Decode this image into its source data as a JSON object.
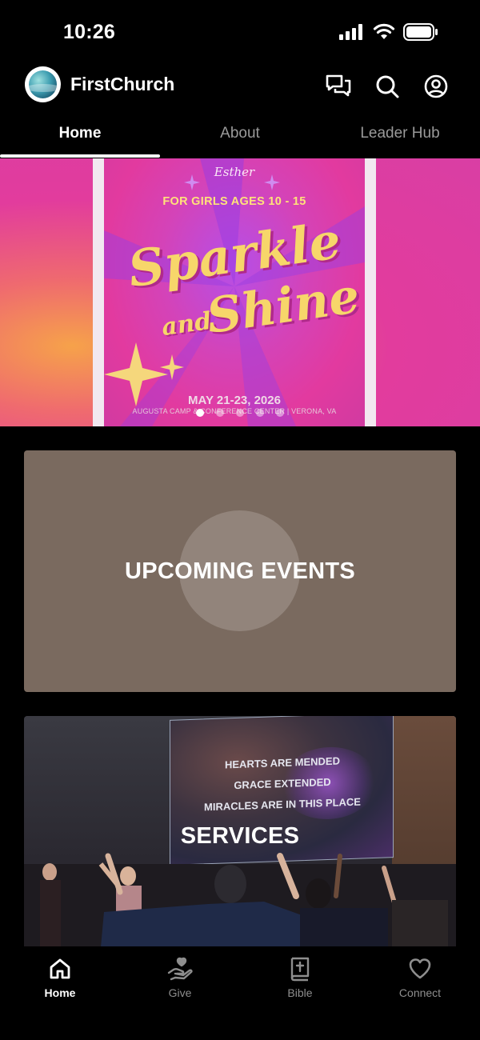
{
  "status_bar": {
    "time": "10:26",
    "icons": [
      "cellular-signal-icon",
      "wifi-icon",
      "battery-icon"
    ]
  },
  "header": {
    "brand_name": "FirstChurch",
    "actions": [
      "chat-icon",
      "search-icon",
      "account-icon"
    ]
  },
  "tabs": [
    {
      "label": "Home",
      "active": true
    },
    {
      "label": "About",
      "active": false
    },
    {
      "label": "Leader Hub",
      "active": false
    }
  ],
  "hero": {
    "poster": {
      "logo_text": "Esther",
      "subtitle": "FOR GIRLS AGES 10 - 15",
      "title_line1": "Sparkle",
      "title_and": "and",
      "title_line2": "Shine",
      "date": "MAY 21-23, 2026",
      "venue": "AUGUSTA CAMP & CONFERENCE CENTER | VERONA, VA"
    },
    "slides_total": 5,
    "active_slide": 1
  },
  "cards": {
    "upcoming_events": "UPCOMING EVENTS",
    "services": "SERVICES",
    "services_screen_lyrics": [
      "HEARTS ARE MENDED",
      "GRACE EXTENDED",
      "MIRACLES ARE IN THIS PLACE"
    ]
  },
  "bottom_nav": [
    {
      "label": "Home",
      "icon": "home-icon",
      "active": true
    },
    {
      "label": "Give",
      "icon": "give-hand-heart-icon",
      "active": false
    },
    {
      "label": "Bible",
      "icon": "bible-icon",
      "active": false
    },
    {
      "label": "Connect",
      "icon": "heart-icon",
      "active": false
    }
  ],
  "colors": {
    "background": "#000000",
    "events_card": "#7a6a5f",
    "inactive_text": "#8e8e8e",
    "poster_gold": "#f7d66a",
    "poster_pink": "#e23a9f"
  }
}
